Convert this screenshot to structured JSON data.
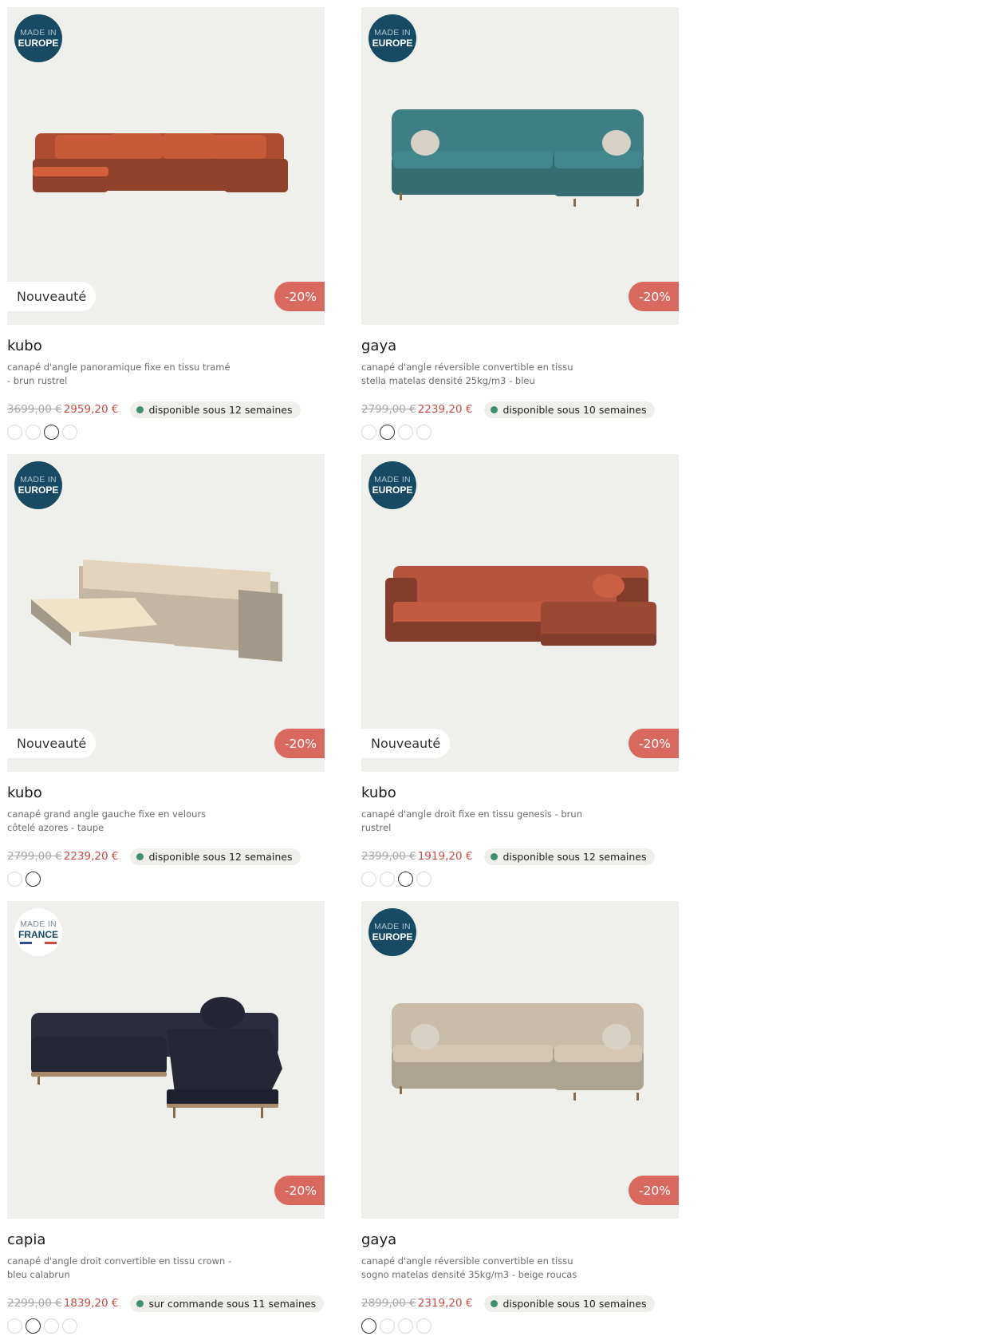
{
  "products": [
    {
      "origin": {
        "line1": "MADE IN",
        "line2": "EUROPE"
      },
      "new_label": "Nouveauté",
      "discount": "-20%",
      "name": "kubo",
      "description": "canapé d'angle panoramique fixe en tissu tramé - brun rustrel",
      "old_price": "3699,00 €",
      "new_price": "2959,20 €",
      "availability": "disponible sous 12 semaines",
      "sofa_color": "#c85a3a",
      "swatches": [
        "#e5d9c7",
        "#1f4a63",
        "#b44f22",
        "#7e8b95"
      ],
      "selected_swatch": 2
    },
    {
      "origin": {
        "line1": "MADE IN",
        "line2": "EUROPE"
      },
      "discount": "-20%",
      "name": "gaya",
      "description": "canapé d'angle réversible convertible en tissu stella matelas densité 25kg/m3 - bleu",
      "old_price": "2799,00 €",
      "new_price": "2239,20 €",
      "availability": "disponible sous 10 semaines",
      "sofa_color": "#3e7f86",
      "swatches": [
        "#e5d9c7",
        "#1f4a63",
        "#6d7c86",
        "#4d5a50"
      ],
      "selected_swatch": 1
    },
    {
      "origin": {
        "line1": "MADE IN",
        "line2": "EUROPE"
      },
      "new_label": "Nouveauté",
      "discount": "-20%",
      "name": "kubo",
      "description": "canapé grand angle gauche fixe en velours côtelé azores - taupe",
      "old_price": "2799,00 €",
      "new_price": "2239,20 €",
      "availability": "disponible sous 12 semaines",
      "sofa_color": "#e3d5bd",
      "swatches": [
        "#e5d9c7",
        "#a99c8c"
      ],
      "selected_swatch": 1
    },
    {
      "origin": {
        "line1": "MADE IN",
        "line2": "EUROPE"
      },
      "new_label": "Nouveauté",
      "discount": "-20%",
      "name": "kubo",
      "description": "canapé d'angle droit fixe en tissu genesis - brun rustrel",
      "old_price": "2399,00 €",
      "new_price": "1919,20 €",
      "availability": "disponible sous 12 semaines",
      "sofa_color": "#b5553d",
      "swatches": [
        "#e5d9c7",
        "#1f4a63",
        "#b44f22",
        "#d6dde2"
      ],
      "selected_swatch": 2
    },
    {
      "origin": {
        "line1": "MADE IN",
        "line2": "FRANCE",
        "variant": "france"
      },
      "discount": "-20%",
      "name": "capia",
      "description": "canapé d'angle droit convertible en tissu crown - bleu calabrun",
      "old_price": "2299,00 €",
      "new_price": "1839,20 €",
      "availability": "sur commande sous 11 semaines",
      "sofa_color": "#2b2d3e",
      "swatches": [
        "#e5d9c7",
        "#2b2d3e",
        "#6d7c86",
        "#4d5a50"
      ],
      "selected_swatch": 1
    },
    {
      "origin": {
        "line1": "MADE IN",
        "line2": "EUROPE"
      },
      "discount": "-20%",
      "name": "gaya",
      "description": "canapé d'angle réversible convertible en tissu sogno matelas densité 35kg/m3 - beige roucas",
      "old_price": "2899,00 €",
      "new_price": "2319,20 €",
      "availability": "disponible sous 10 semaines",
      "sofa_color": "#c9bda9",
      "swatches": [
        "#e5d9c7",
        "#1f4a63",
        "#6d7c86",
        "#4d5a50"
      ],
      "selected_swatch": 0
    }
  ]
}
